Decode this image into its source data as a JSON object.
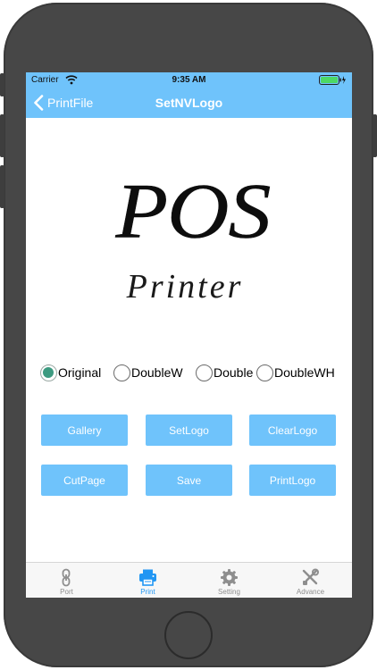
{
  "status_bar": {
    "carrier": "Carrier",
    "time": "9:35 AM",
    "wifi_icon": "wifi-icon",
    "battery_icon": "battery-charging-icon"
  },
  "nav": {
    "back_label": "PrintFile",
    "back_icon": "chevron-left-icon",
    "title": "SetNVLogo"
  },
  "logo": {
    "line1": "POS",
    "line2": "Printer"
  },
  "size_options": {
    "selected": "Original",
    "options": [
      "Original",
      "DoubleW",
      "DoubleH",
      "DoubleWH"
    ],
    "visible_labels": [
      "Original",
      "DoubleW",
      "Double",
      "DoubleWH"
    ]
  },
  "buttons": {
    "gallery": "Gallery",
    "set_logo": "SetLogo",
    "clear_logo": "ClearLogo",
    "cut_page": "CutPage",
    "save": "Save",
    "print_logo": "PrintLogo"
  },
  "tabs": [
    {
      "label": "Port",
      "icon": "link-icon"
    },
    {
      "label": "Print",
      "icon": "printer-icon",
      "active": true
    },
    {
      "label": "Setting",
      "icon": "gear-icon"
    },
    {
      "label": "Advance",
      "icon": "tools-icon"
    }
  ],
  "colors": {
    "accent": "#6fc3fb",
    "radio_checked": "#3c9a80",
    "tab_active": "#2196f3",
    "tab_inactive": "#8e8e8e",
    "phone_body": "#474747"
  }
}
